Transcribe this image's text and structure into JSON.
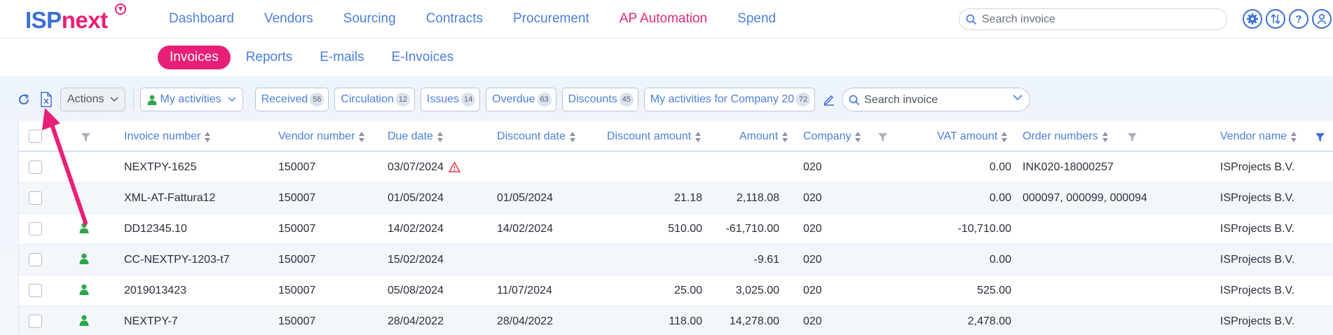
{
  "logo": {
    "part1": "ISP",
    "part2": "next"
  },
  "nav": {
    "items": [
      "Dashboard",
      "Vendors",
      "Sourcing",
      "Contracts",
      "Procurement",
      "AP Automation",
      "Spend"
    ],
    "active": "AP Automation"
  },
  "top_search": {
    "placeholder": "Search invoice"
  },
  "top_icons": [
    "gear-icon",
    "sort-arrows-icon",
    "help-icon",
    "user-icon"
  ],
  "subnav": {
    "items": [
      "Invoices",
      "Reports",
      "E-mails",
      "E-Invoices"
    ],
    "active": "Invoices"
  },
  "toolbar": {
    "actions_label": "Actions",
    "my_activities_label": "My activities",
    "filters": [
      {
        "label": "Received",
        "count": "56"
      },
      {
        "label": "Circulation",
        "count": "12"
      },
      {
        "label": "Issues",
        "count": "14"
      },
      {
        "label": "Overdue",
        "count": "63"
      },
      {
        "label": "Discounts",
        "count": "45"
      },
      {
        "label": "My activities for Company 20",
        "count": "72"
      }
    ],
    "search_placeholder": "Search invoice"
  },
  "table": {
    "columns": [
      "Invoice number",
      "Vendor number",
      "Due date",
      "Discount date",
      "Discount amount",
      "Amount",
      "Company",
      "VAT amount",
      "Order numbers",
      "Vendor name"
    ],
    "rows": [
      {
        "invoice": "NEXTPY-1625",
        "vendor_no": "150007",
        "due": "03/07/2024",
        "due_warning": true,
        "disc_date": "",
        "disc_amount": "",
        "amount": "",
        "company": "020",
        "vat": "0.00",
        "orders": "INK020-18000257",
        "vendor_name": "ISProjects B.V.",
        "person": false
      },
      {
        "invoice": "XML-AT-Fattura12",
        "vendor_no": "150007",
        "due": "01/05/2024",
        "due_warning": false,
        "disc_date": "01/05/2024",
        "disc_amount": "21.18",
        "amount": "2,118.08",
        "company": "020",
        "vat": "0.00",
        "orders": "000097, 000099, 000094",
        "vendor_name": "ISProjects B.V.",
        "person": false
      },
      {
        "invoice": "DD12345.10",
        "vendor_no": "150007",
        "due": "14/02/2024",
        "due_warning": false,
        "disc_date": "14/02/2024",
        "disc_amount": "510.00",
        "amount": "-61,710.00",
        "company": "020",
        "vat": "-10,710.00",
        "orders": "",
        "vendor_name": "ISProjects B.V.",
        "person": true
      },
      {
        "invoice": "CC-NEXTPY-1203-t7",
        "vendor_no": "150007",
        "due": "15/02/2024",
        "due_warning": false,
        "disc_date": "",
        "disc_amount": "",
        "amount": "-9.61",
        "company": "020",
        "vat": "0.00",
        "orders": "",
        "vendor_name": "ISProjects B.V.",
        "person": true
      },
      {
        "invoice": "2019013423",
        "vendor_no": "150007",
        "due": "05/08/2024",
        "due_warning": false,
        "disc_date": "11/07/2024",
        "disc_amount": "25.00",
        "amount": "3,025.00",
        "company": "020",
        "vat": "525.00",
        "orders": "",
        "vendor_name": "ISProjects B.V.",
        "person": true
      },
      {
        "invoice": "NEXTPY-7",
        "vendor_no": "150007",
        "due": "28/04/2022",
        "due_warning": false,
        "disc_date": "28/04/2022",
        "disc_amount": "118.00",
        "amount": "14,278.00",
        "company": "020",
        "vat": "2,478.00",
        "orders": "",
        "vendor_name": "ISProjects B.V.",
        "person": true
      }
    ]
  },
  "colors": {
    "accent_pink": "#e81f76",
    "link_blue": "#4c7fd9",
    "person_green": "#2ea64a",
    "warning_red": "#e0393e"
  }
}
